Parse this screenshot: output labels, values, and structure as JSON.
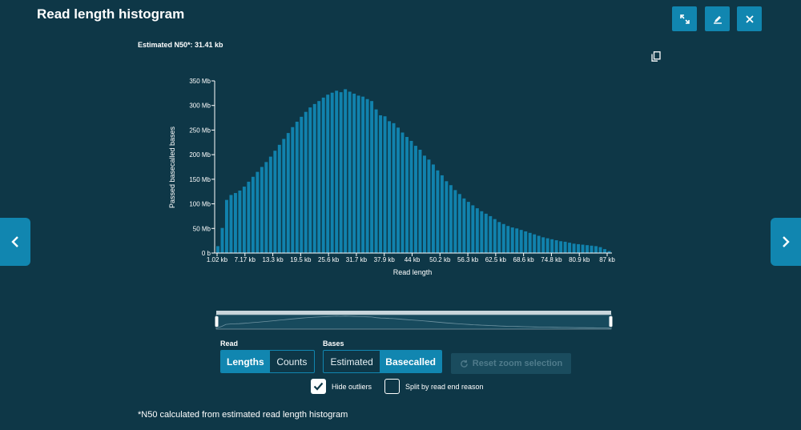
{
  "header": {
    "title": "Read length histogram"
  },
  "toolbar": {
    "expand_icon": "expand-icon",
    "edit_icon": "edit-icon",
    "close_icon": "close-icon"
  },
  "n50_label": "Estimated N50*: 31.41 kb",
  "controls": {
    "read_label": "Read",
    "read_options": [
      "Lengths",
      "Counts"
    ],
    "read_selected": "Lengths",
    "bases_label": "Bases",
    "bases_options": [
      "Estimated",
      "Basecalled"
    ],
    "bases_selected": "Basecalled",
    "reset_label": "Reset zoom selection",
    "hide_outliers_label": "Hide outliers",
    "hide_outliers_checked": true,
    "split_label": "Split by read end reason",
    "split_checked": false
  },
  "footnote": "*N50 calculated from estimated read length histogram",
  "colors": {
    "bar": "#1182ad",
    "background": "#0e3747",
    "accent": "#1186b0"
  },
  "chart_data": {
    "type": "bar",
    "xlabel": "Read length",
    "ylabel": "Passed basecalled bases",
    "ylim": [
      0,
      350
    ],
    "yunit": "Mb",
    "yticks": [
      "0 b",
      "50 Mb",
      "100 Mb",
      "150 Mb",
      "200 Mb",
      "250 Mb",
      "300 Mb",
      "350 Mb"
    ],
    "xticks": [
      "1.02 kb",
      "7.17 kb",
      "13.3 kb",
      "19.5 kb",
      "25.6 kb",
      "31.7 kb",
      "37.9 kb",
      "44 kb",
      "50.2 kb",
      "56.3 kb",
      "62.5 kb",
      "68.6 kb",
      "74.8 kb",
      "80.9 kb",
      "87 kb"
    ],
    "grid": false,
    "values": [
      14,
      51,
      108,
      118,
      122,
      127,
      135,
      145,
      155,
      165,
      175,
      185,
      196,
      208,
      220,
      232,
      244,
      256,
      267,
      277,
      287,
      296,
      303,
      309,
      316,
      322,
      326,
      330,
      327,
      333,
      328,
      324,
      320,
      318,
      313,
      309,
      292,
      280,
      278,
      268,
      264,
      255,
      245,
      236,
      228,
      218,
      210,
      198,
      190,
      180,
      168,
      158,
      146,
      138,
      128,
      120,
      111,
      104,
      97,
      91,
      85,
      80,
      75,
      69,
      63,
      59,
      55,
      52,
      50,
      47,
      44,
      41,
      38,
      35,
      32,
      30,
      28,
      26,
      24,
      23,
      21,
      19,
      18,
      17,
      16,
      15,
      14,
      12,
      8,
      4
    ]
  }
}
